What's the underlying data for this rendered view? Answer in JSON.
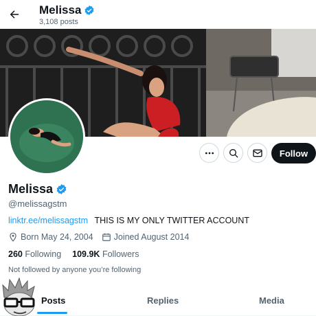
{
  "header": {
    "title": "Melissa",
    "posts_count": "3,108 posts"
  },
  "profile": {
    "name": "Melissa",
    "handle": "@melissagstm",
    "bio_link": "linktr.ee/melissagstm",
    "bio_text": "THIS IS MY ONLY TWITTER ACCOUNT",
    "born": "Born May 24, 2004",
    "joined": "Joined August 2014",
    "following_count": "260",
    "following_label": "Following",
    "followers_count": "109.9K",
    "followers_label": "Followers",
    "not_followed": "Not followed by anyone you’re following"
  },
  "actions": {
    "follow_label": "Follow"
  },
  "tabs": [
    {
      "label": "Posts",
      "active": true
    },
    {
      "label": "Replies",
      "active": false
    },
    {
      "label": "Media",
      "active": false
    }
  ],
  "colors": {
    "accent": "#1d9bf0",
    "text": "#0f1419",
    "muted": "#536471",
    "button": "#0f1419"
  },
  "icons": [
    "back-arrow-icon",
    "verified-badge-icon",
    "more-icon",
    "search-icon",
    "mail-icon",
    "location-icon",
    "calendar-icon"
  ]
}
